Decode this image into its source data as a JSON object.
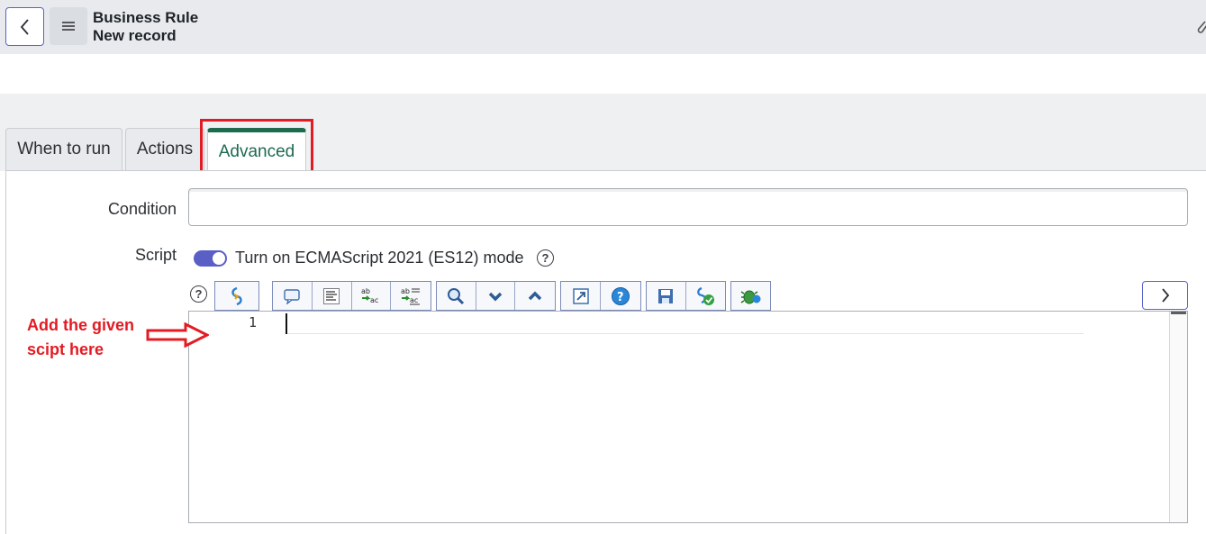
{
  "header": {
    "title": "Business Rule",
    "subtitle": "New record",
    "back_icon": "chevron-left-icon",
    "menu_icon": "hamburger-menu-icon",
    "attach_icon": "paperclip-icon"
  },
  "tabs": [
    {
      "label": "When to run",
      "active": false
    },
    {
      "label": "Actions",
      "active": false
    },
    {
      "label": "Advanced",
      "active": true
    }
  ],
  "form": {
    "condition_label": "Condition",
    "condition_value": "",
    "script_label": "Script",
    "es12_toggle_label": "Turn on ECMAScript 2021 (ES12) mode",
    "es12_toggle_on": true
  },
  "toolbar": {
    "help_icon": "help-icon",
    "groups": [
      [
        "format-code-icon"
      ],
      [
        "comment-icon",
        "format-block-icon",
        "replace-icon",
        "replace-all-icon"
      ],
      [
        "search-icon",
        "next-match-icon",
        "previous-match-icon"
      ],
      [
        "fullscreen-icon",
        "script-help-icon"
      ],
      [
        "save-icon",
        "validate-script-icon"
      ],
      [
        "debug-icon"
      ]
    ],
    "next_icon": "chevron-right-icon"
  },
  "editor": {
    "line_numbers": [
      "1"
    ],
    "content": ""
  },
  "annotation": {
    "line1": "Add the given",
    "line2": "scipt here",
    "color": "#e31b23"
  },
  "colors": {
    "accent": "#5a5fc6",
    "active_tab": "#1d6b4d",
    "highlight": "#e31b23"
  }
}
